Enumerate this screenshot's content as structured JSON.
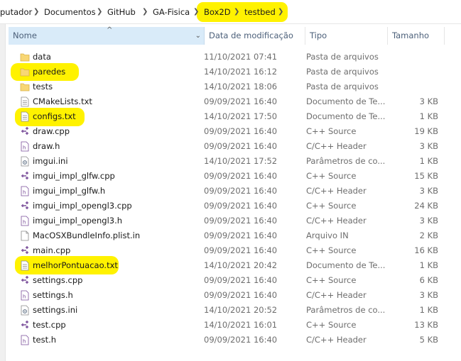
{
  "breadcrumb": {
    "items": [
      "putador",
      "Documentos",
      "GitHub",
      "GA-Fisica",
      "Box2D",
      "testbed"
    ]
  },
  "columns": {
    "name": "Nome",
    "date": "Data de modificação",
    "type": "Tipo",
    "size": "Tamanho"
  },
  "files": [
    {
      "name": "data",
      "date": "11/10/2021 07:41",
      "type": "Pasta de arquivos",
      "size": "",
      "icon": "folder-icon"
    },
    {
      "name": "paredes",
      "date": "14/10/2021 16:12",
      "type": "Pasta de arquivos",
      "size": "",
      "icon": "folder-icon"
    },
    {
      "name": "tests",
      "date": "14/10/2021 18:06",
      "type": "Pasta de arquivos",
      "size": "",
      "icon": "folder-icon"
    },
    {
      "name": "CMakeLists.txt",
      "date": "09/09/2021 16:40",
      "type": "Documento de Te...",
      "size": "3 KB",
      "icon": "text-file-icon"
    },
    {
      "name": "configs.txt",
      "date": "14/10/2021 17:50",
      "type": "Documento de Te...",
      "size": "1 KB",
      "icon": "text-file-icon"
    },
    {
      "name": "draw.cpp",
      "date": "09/09/2021 16:40",
      "type": "C++ Source",
      "size": "19 KB",
      "icon": "cpp-source-icon"
    },
    {
      "name": "draw.h",
      "date": "09/09/2021 16:40",
      "type": "C/C++ Header",
      "size": "3 KB",
      "icon": "header-file-icon"
    },
    {
      "name": "imgui.ini",
      "date": "14/10/2021 17:52",
      "type": "Parâmetros de co...",
      "size": "1 KB",
      "icon": "settings-file-icon"
    },
    {
      "name": "imgui_impl_glfw.cpp",
      "date": "09/09/2021 16:40",
      "type": "C++ Source",
      "size": "15 KB",
      "icon": "cpp-source-icon"
    },
    {
      "name": "imgui_impl_glfw.h",
      "date": "09/09/2021 16:40",
      "type": "C/C++ Header",
      "size": "3 KB",
      "icon": "header-file-icon"
    },
    {
      "name": "imgui_impl_opengl3.cpp",
      "date": "09/09/2021 16:40",
      "type": "C++ Source",
      "size": "24 KB",
      "icon": "cpp-source-icon"
    },
    {
      "name": "imgui_impl_opengl3.h",
      "date": "09/09/2021 16:40",
      "type": "C/C++ Header",
      "size": "3 KB",
      "icon": "header-file-icon"
    },
    {
      "name": "MacOSXBundleInfo.plist.in",
      "date": "09/09/2021 16:40",
      "type": "Arquivo IN",
      "size": "2 KB",
      "icon": "generic-file-icon"
    },
    {
      "name": "main.cpp",
      "date": "09/09/2021 16:40",
      "type": "C++ Source",
      "size": "16 KB",
      "icon": "cpp-source-icon"
    },
    {
      "name": "melhorPontuacao.txt",
      "date": "14/10/2021 20:42",
      "type": "Documento de Te...",
      "size": "1 KB",
      "icon": "text-file-icon"
    },
    {
      "name": "settings.cpp",
      "date": "09/09/2021 16:40",
      "type": "C++ Source",
      "size": "6 KB",
      "icon": "cpp-source-icon"
    },
    {
      "name": "settings.h",
      "date": "09/09/2021 16:40",
      "type": "C/C++ Header",
      "size": "3 KB",
      "icon": "header-file-icon"
    },
    {
      "name": "settings.ini",
      "date": "14/10/2021 20:52",
      "type": "Parâmetros de co...",
      "size": "1 KB",
      "icon": "settings-file-icon"
    },
    {
      "name": "test.cpp",
      "date": "14/10/2021 16:01",
      "type": "C++ Source",
      "size": "13 KB",
      "icon": "cpp-source-icon"
    },
    {
      "name": "test.h",
      "date": "09/09/2021 16:40",
      "type": "C/C++ Header",
      "size": "5 KB",
      "icon": "header-file-icon"
    }
  ],
  "colors": {
    "highlight": "#fff200",
    "header_selected": "#d9ebf9",
    "folder": "#f8d775",
    "cpp_accent": "#7a4f9a"
  }
}
